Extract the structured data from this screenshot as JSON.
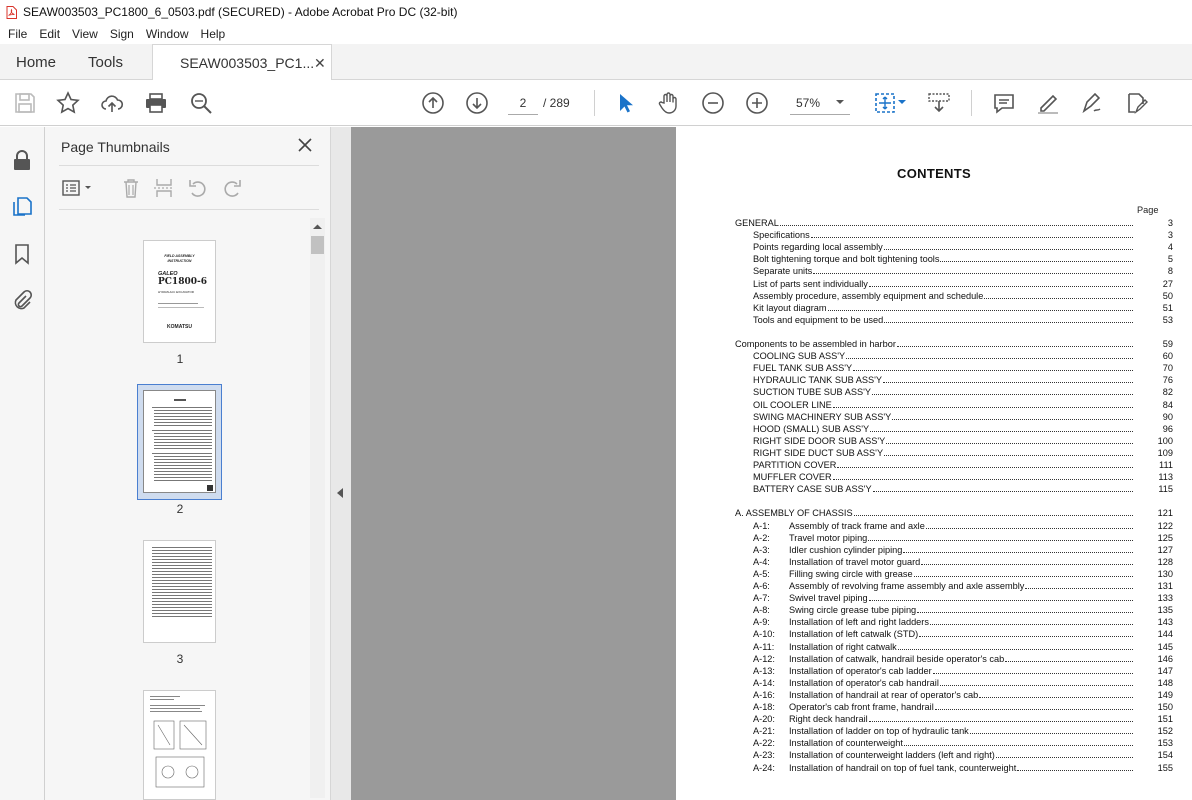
{
  "window": {
    "title": "SEAW003503_PC1800_6_0503.pdf (SECURED) - Adobe Acrobat Pro DC (32-bit)"
  },
  "menu": [
    "File",
    "Edit",
    "View",
    "Sign",
    "Window",
    "Help"
  ],
  "tabs": {
    "home": "Home",
    "tools": "Tools",
    "document": "SEAW003503_PC1..."
  },
  "toolbar": {
    "page_current": "2",
    "page_total": "/  289",
    "zoom": "57%"
  },
  "panel": {
    "title": "Page Thumbnails",
    "thumbnails": [
      "1",
      "2",
      "3"
    ]
  },
  "thumb1": {
    "lines": [
      "FIELD  ASSEMBLY",
      "INSTRUCTION",
      "GALEO",
      "PC1800-6",
      "HYDRAULIC  EXCAVATOR",
      "KOMATSU"
    ]
  },
  "doc": {
    "heading": "CONTENTS",
    "page_label": "Page",
    "rows": [
      {
        "indent": 0,
        "code": "",
        "text": "GENERAL",
        "page": "3"
      },
      {
        "indent": 1,
        "code": "",
        "text": "Specifications",
        "page": "3"
      },
      {
        "indent": 1,
        "code": "",
        "text": "Points  regarding  local  assembly",
        "page": "4"
      },
      {
        "indent": 1,
        "code": "",
        "text": "Bolt  tightening  torque  and  bolt  tightening  tools",
        "page": "5"
      },
      {
        "indent": 1,
        "code": "",
        "text": "Separate  units",
        "page": "8"
      },
      {
        "indent": 1,
        "code": "",
        "text": "List  of  parts  sent  individually",
        "page": "27"
      },
      {
        "indent": 1,
        "code": "",
        "text": "Assembly  procedure,  assembly  equipment  and  schedule",
        "page": "50"
      },
      {
        "indent": 1,
        "code": "",
        "text": "Kit  layout  diagram",
        "page": "51"
      },
      {
        "indent": 1,
        "code": "",
        "text": "Tools  and  equipment  to  be  used",
        "page": "53"
      },
      {
        "indent": 0,
        "code": "",
        "text": "Components  to  be  assembled  in  harbor",
        "page": "59",
        "gap": true
      },
      {
        "indent": 1,
        "code": "",
        "text": "COOLING  SUB  ASS'Y",
        "page": "60"
      },
      {
        "indent": 1,
        "code": "",
        "text": "FUEL  TANK  SUB  ASS'Y",
        "page": "70"
      },
      {
        "indent": 1,
        "code": "",
        "text": "HYDRAULIC  TANK  SUB  ASS'Y",
        "page": "76"
      },
      {
        "indent": 1,
        "code": "",
        "text": "SUCTION  TUBE  SUB  ASS'Y",
        "page": "82"
      },
      {
        "indent": 1,
        "code": "",
        "text": "OIL  COOLER  LINE",
        "page": "84"
      },
      {
        "indent": 1,
        "code": "",
        "text": "SWING  MACHINERY  SUB  ASS'Y",
        "page": "90"
      },
      {
        "indent": 1,
        "code": "",
        "text": "HOOD  (SMALL)  SUB  ASS'Y",
        "page": "96"
      },
      {
        "indent": 1,
        "code": "",
        "text": "RIGHT  SIDE  DOOR  SUB  ASS'Y",
        "page": "100"
      },
      {
        "indent": 1,
        "code": "",
        "text": "RIGHT  SIDE  DUCT  SUB  ASS'Y",
        "page": "109"
      },
      {
        "indent": 1,
        "code": "",
        "text": "PARTITION  COVER",
        "page": "111"
      },
      {
        "indent": 1,
        "code": "",
        "text": "MUFFLER  COVER",
        "page": "113"
      },
      {
        "indent": 1,
        "code": "",
        "text": "BATTERY  CASE  SUB  ASS'Y",
        "page": "115"
      },
      {
        "indent": 0,
        "code": "",
        "text": "A.  ASSEMBLY  OF  CHASSIS",
        "page": "121",
        "gap": true
      },
      {
        "indent": 1,
        "code": "A-1:",
        "text": "Assembly  of  track  frame  and  axle",
        "page": "122"
      },
      {
        "indent": 1,
        "code": "A-2:",
        "text": "Travel  motor  piping",
        "page": "125"
      },
      {
        "indent": 1,
        "code": "A-3:",
        "text": "Idler  cushion  cylinder  piping",
        "page": "127"
      },
      {
        "indent": 1,
        "code": "A-4:",
        "text": "Installation  of  travel  motor  guard",
        "page": "128"
      },
      {
        "indent": 1,
        "code": "A-5:",
        "text": "Filling  swing  circle  with  grease",
        "page": "130"
      },
      {
        "indent": 1,
        "code": "A-6:",
        "text": "Assembly  of  revolving  frame  assembly  and  axle  assembly",
        "page": "131"
      },
      {
        "indent": 1,
        "code": "A-7:",
        "text": "Swivel  travel  piping",
        "page": "133"
      },
      {
        "indent": 1,
        "code": "A-8:",
        "text": "Swing  circle  grease  tube  piping",
        "page": "135"
      },
      {
        "indent": 1,
        "code": "A-9:",
        "text": "Installation  of  left  and  right  ladders",
        "page": "143"
      },
      {
        "indent": 1,
        "code": "A-10:",
        "text": "Installation  of  left  catwalk  (STD)",
        "page": "144"
      },
      {
        "indent": 1,
        "code": "A-11:",
        "text": "Installation  of  right  catwalk",
        "page": "145"
      },
      {
        "indent": 1,
        "code": "A-12:",
        "text": "Installation  of  catwalk,  handrail  beside  operator's  cab",
        "page": "146"
      },
      {
        "indent": 1,
        "code": "A-13:",
        "text": "Installation  of  operator's  cab  ladder",
        "page": "147"
      },
      {
        "indent": 1,
        "code": "A-14:",
        "text": "Installation  of  operator's  cab  handrail",
        "page": "148"
      },
      {
        "indent": 1,
        "code": "A-16:",
        "text": "Installation  of  handrail  at  rear  of  operator's  cab",
        "page": "149"
      },
      {
        "indent": 1,
        "code": "A-18:",
        "text": "Operator's  cab  front  frame,  handrail",
        "page": "150"
      },
      {
        "indent": 1,
        "code": "A-20:",
        "text": "Right  deck  handrail",
        "page": "151"
      },
      {
        "indent": 1,
        "code": "A-21:",
        "text": "Installation  of  ladder  on  top  of  hydraulic  tank",
        "page": "152"
      },
      {
        "indent": 1,
        "code": "A-22:",
        "text": "Installation  of  counterweight",
        "page": "153"
      },
      {
        "indent": 1,
        "code": "A-23:",
        "text": "Installation  of  counterweight  ladders  (left  and  right)",
        "page": "154"
      },
      {
        "indent": 1,
        "code": "A-24:",
        "text": "Installation  of  handrail  on  top  of  fuel  tank,  counterweight",
        "page": "155"
      }
    ]
  },
  "colors": {
    "accent": "#4a7fd0",
    "pdf_red": "#d9342b",
    "gray_canvas": "#9a9a9a"
  }
}
